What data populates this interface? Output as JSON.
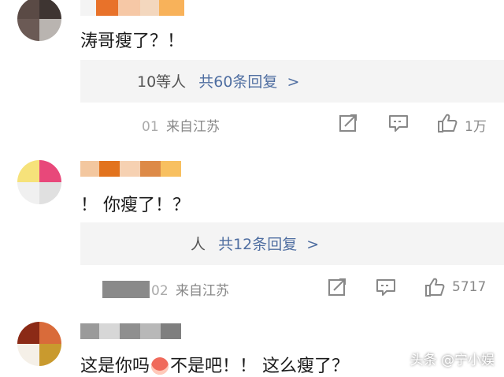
{
  "comments": [
    {
      "text": "涛哥瘦了？！",
      "reply_prefix": "10等人",
      "reply_count": "共60条回复",
      "reply_chevron": ">",
      "source_prefix": "01",
      "source": "来自江苏",
      "likes": "1万",
      "avatar_colors": [
        "#5a4a45",
        "#3e3532",
        "#6b5a55",
        "#b9b4b0"
      ],
      "name_colors": [
        "#e8722a",
        "#f6c8a6",
        "#f3d7be",
        "#f8b25a"
      ]
    },
    {
      "text": "！ 你瘦了！？",
      "reply_prefix": "人",
      "reply_count": "共12条回复",
      "reply_chevron": ">",
      "source_prefix": "02",
      "source": "来自江苏",
      "likes": "5717",
      "avatar_colors": [
        "#f6e27a",
        "#e8487a",
        "#f0f0f0",
        "#e0e0e0"
      ],
      "name_colors": [
        "#f3c79f",
        "#e2731e",
        "#f6d1b2",
        "#dd8a48",
        "#f8c060"
      ]
    },
    {
      "text_before": "这是你吗",
      "text_after": "不是吧！！ 这么瘦了？",
      "avatar_colors": [
        "#8b2a16",
        "#d96b3a",
        "#f5f0e8",
        "#c99a2e"
      ],
      "name_colors": [
        "#9a9a9a",
        "#d7d7d7",
        "#8f8f8f",
        "#b8b8b8",
        "#7f7f7f"
      ]
    }
  ],
  "watermark": "头条 @宁小娱",
  "icons": [
    "share-icon",
    "comment-icon",
    "like-icon"
  ]
}
